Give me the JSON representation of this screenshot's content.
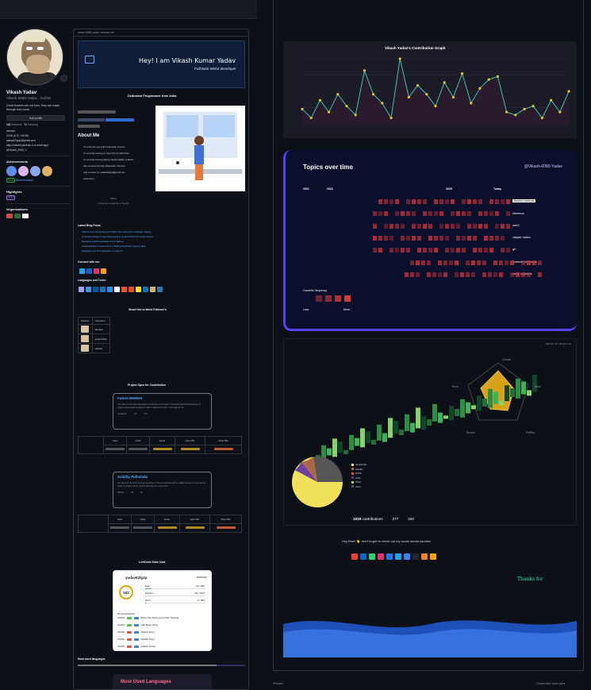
{
  "profile": {
    "name": "Vikash Yadav",
    "login": "Vikash-6080-Yadav · he/him",
    "bio": "Great leaders are not born, they are made through hard work.",
    "edit_label": "Edit profile",
    "followers": "182",
    "followers_label": "followers",
    "following": "72",
    "following_label": "following",
    "details": [
      "minions",
      "23:38 (UTC +05:30)",
      "yadav62/gopi@gmail.com",
      "https://vikash-portfolio-3.d.vercel.app/",
      "@Vikash_6080_Y"
    ],
    "achievements_label": "Achievements",
    "beta_label": "Beta",
    "send_feedback": "Send feedback",
    "highlights_label": "Highlights",
    "pro_label": "PRO",
    "organizations_label": "Organizations"
  },
  "readme": {
    "path": "vikash-6080-yadav / readme.md",
    "banner_title": "Hey! I am Vikash Kumar Yadav",
    "banner_sub": "Fullstack Web3 developer",
    "dedicated": "Dedicated Programmer from India",
    "about_title": "About Me",
    "about_items": [
      "I'm at the 4th year of B.S Computer Science",
      "I'm currently working on Open Source Web3 Dev",
      "I'm currently learning Django,Nextjs,Solidity, js,Redux",
      "Ask me about DevOps, Blockchain, DevOps",
      "How to reach me: yadav62/gopi@gmail.com",
      "Listening to:"
    ],
    "offline": "Offline",
    "spotify": "Currently not playing on Spotify",
    "blog_title": "Latest Blog Posts",
    "blog_posts": [
      "AWS for Free: Empowering the AWS Community with Knowledge Sharing",
      "Automating Docker Image Deployment to Amazon ECR with GitHub Actions",
      "Deploying a Web3 Application to the Splines",
      "Understanding a Contract fix for a Node.js Application Step-by-Step",
      "Deploying Your First Application on App CD"
    ],
    "connect_title": "Connect with me:",
    "languages_title": "Languages and Tools:",
    "shoutout_title": "Shout Out to latest Follower's",
    "followers_table": {
      "headers": [
        "Follower",
        "Username"
      ],
      "rows": [
        "akpriteoi",
        "geekeekaigr",
        "vaibhav"
      ]
    },
    "open_title": "Project Open for Contribution",
    "repos": [
      {
        "name": "Future.WebNet",
        "desc": "Our place for the web3 developer to showcase their project. This Repo Web3 World consists of projects (decentralized apps) to build on Ethereum Chain. This make for the...",
        "lang": "JavaScript",
        "stars": "177",
        "forks": "157"
      },
      {
        "name": "Solidity-Pathshala",
        "desc": "Our place for the smart contract developer. This repo will have all the solidity contracts in the repo as a site. It contains all the source code with the smart chain.",
        "lang": "Solidity",
        "stars": "30",
        "forks": "38"
      }
    ],
    "stat_headers": [
      "Stars",
      "Forks",
      "Issues",
      "Open PRs",
      "Close PRs"
    ],
    "leetcode_title": "LeetCode Stats Card",
    "leetcode": {
      "user": "yadav62lgzp",
      "rank": "#1030020",
      "solved": "152",
      "rows": [
        {
          "label": "Easy",
          "value": "92 / 836"
        },
        {
          "label": "Medium",
          "value": "38 / 1675"
        },
        {
          "label": "Hard",
          "value": "2 / 681"
        }
      ],
      "activity_title": "Recent Activities",
      "activity": [
        {
          "date": "23/1/28",
          "title": "Binary Tree Zigzag Level Order Traversal"
        },
        {
          "date": "23/1/28",
          "title": "Valid Binary String"
        },
        {
          "date": "23/1/28",
          "title": "Reliable String"
        },
        {
          "date": "23/1/28",
          "title": "Reliable String"
        },
        {
          "date": "23/1/28",
          "title": "Reliable Sorters"
        }
      ]
    },
    "most_used_title": "Most used languages",
    "most_used_card": "Most Used Languages"
  },
  "right": {
    "graph_title": "Vikash Yadav's Contribution Graph",
    "topics_title": "Topics over time",
    "topics_user": "@Vikash-6080-Yadav",
    "years": [
      "2021",
      "2023",
      "2025",
      "Today"
    ],
    "topics": [
      "fashion controls",
      "ethereum",
      "web3",
      "clapper nation",
      "git",
      "frontend framework",
      "smart contracts"
    ],
    "commit_freq": "Commits frequency",
    "less": "Less",
    "more": "More",
    "iso_date": "2021-07-11 / 2023-07-11",
    "radar_labels": [
      "Commit",
      "Issue",
      "PullReq",
      "Review",
      "Repo"
    ],
    "legend": [
      {
        "name": "JavaScript",
        "color": "#f1e05a"
      },
      {
        "name": "Solidity",
        "color": "#aa6746"
      },
      {
        "name": "HTML",
        "color": "#e34c26"
      },
      {
        "name": "CSS",
        "color": "#563d7c"
      },
      {
        "name": "Shell",
        "color": "#89e051"
      },
      {
        "name": "other",
        "color": "#555555"
      }
    ],
    "contributions": "1819",
    "contributions_label": "contributions",
    "stars": "277",
    "forks": "260",
    "social_text": "Hey,Reel! 👋 don't forget to check out my social media handles",
    "thanks": "Thanks for",
    "footer_left": "Pinned",
    "footer_right": "Customize your pins"
  },
  "chart_data": {
    "type": "line",
    "title": "Vikash Yadav's Contribution Graph",
    "x": [
      1,
      2,
      3,
      4,
      5,
      6,
      7,
      8,
      9,
      10,
      11,
      12,
      13,
      14,
      15,
      16,
      17,
      18,
      19,
      20,
      21,
      22,
      23,
      24,
      25,
      26,
      27,
      28,
      29,
      30,
      31
    ],
    "values": [
      5,
      2,
      8,
      4,
      10,
      6,
      3,
      18,
      10,
      7,
      2,
      22,
      9,
      13,
      10,
      6,
      14,
      9,
      17,
      7,
      12,
      15,
      16,
      4,
      3,
      5,
      6,
      2,
      8,
      4,
      11
    ]
  }
}
